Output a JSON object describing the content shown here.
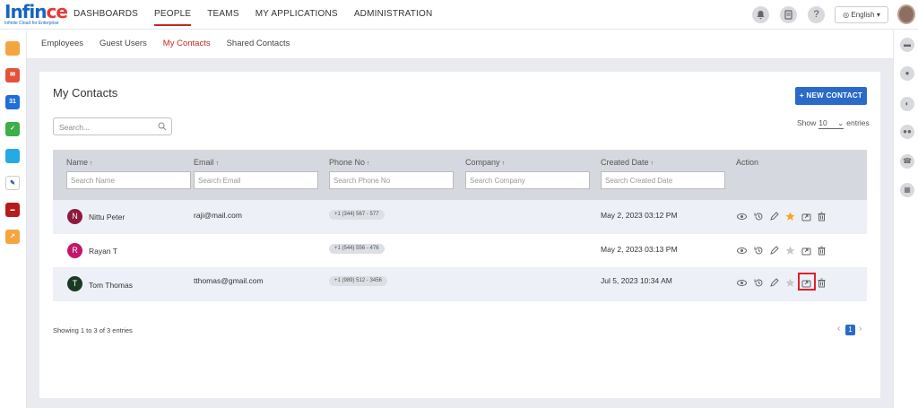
{
  "brand": {
    "name_main": "Infin",
    "name_accent": "ce",
    "tagline": "Infinite Cloud for Enterprise"
  },
  "top_nav": [
    "DASHBOARDS",
    "PEOPLE",
    "TEAMS",
    "MY APPLICATIONS",
    "ADMINISTRATION"
  ],
  "top_nav_active": "PEOPLE",
  "top_right": {
    "language": "English"
  },
  "sub_nav": [
    "Employees",
    "Guest Users",
    "My Contacts",
    "Shared Contacts"
  ],
  "sub_nav_active": "My Contacts",
  "page": {
    "title": "My Contacts",
    "new_contact_label": "+ NEW CONTACT",
    "search_placeholder": "Search...",
    "show_label": "Show",
    "page_size": "10",
    "entries_label": "entries"
  },
  "table": {
    "columns": [
      {
        "label": "Name",
        "placeholder": "Search Name"
      },
      {
        "label": "Email",
        "placeholder": "Search Email"
      },
      {
        "label": "Phone No",
        "placeholder": "Search Phone No"
      },
      {
        "label": "Company",
        "placeholder": "Search Company"
      },
      {
        "label": "Created Date",
        "placeholder": "Search Created Date"
      },
      {
        "label": "Action"
      }
    ],
    "rows": [
      {
        "initial": "N",
        "name": "Nittu Peter",
        "email": "raji@mail.com",
        "phone": "+1 (344) 567 - 577",
        "company": "",
        "created": "May 2, 2023 03:12 PM",
        "favorite": true,
        "avatar_color": "#8e1b3c"
      },
      {
        "initial": "R",
        "name": "Rayan T",
        "email": "",
        "phone": "+1 (544) 556 - 476",
        "company": "",
        "created": "May 2, 2023 03:13 PM",
        "favorite": false,
        "avatar_color": "#c2186b"
      },
      {
        "initial": "T",
        "name": "Tom Thomas",
        "email": "tthomas@gmail.com",
        "phone": "+1 (989) 512 - 3456",
        "company": "",
        "created": "Jul 5, 2023 10:34 AM",
        "favorite": false,
        "avatar_color": "#1b3a24"
      }
    ]
  },
  "footer": {
    "info": "Showing 1 to 3 of 3 entries",
    "current_page": "1",
    "prev": "‹",
    "next": "›"
  },
  "colors": {
    "accent": "#c62828",
    "primary": "#2a6ac8",
    "star_active": "#f5a623",
    "highlight": "#e0202a"
  }
}
